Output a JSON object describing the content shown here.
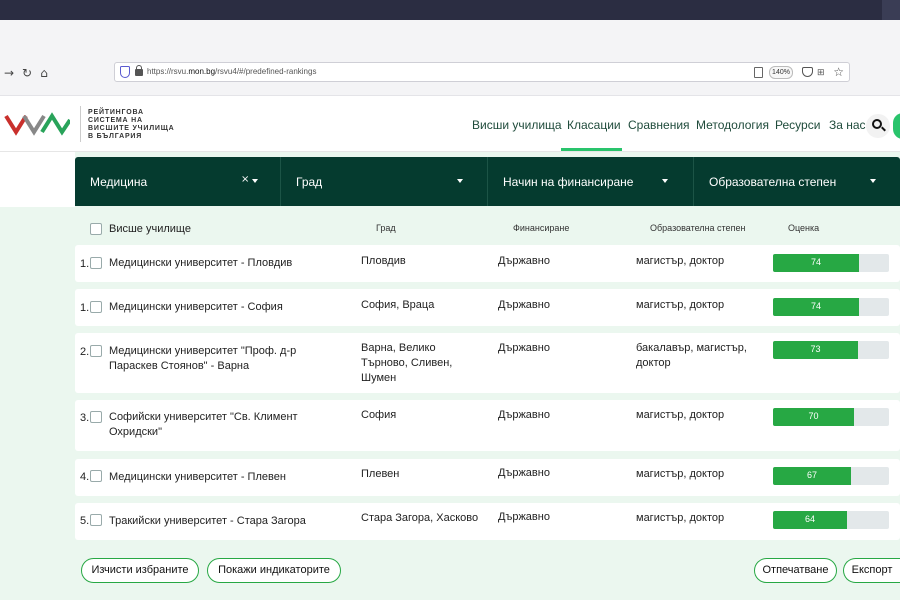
{
  "browser": {
    "url_prefix": "https://rsvu.",
    "url_domain": "mon.bg",
    "url_suffix": "/rsvu4/#/predefined-rankings",
    "zoom": "140%"
  },
  "site": {
    "logo_lines": [
      "РЕЙТИНГОВА",
      "СИСТЕМА НА",
      "ВИСШИТЕ УЧИЛИЩА",
      "В БЪЛГАРИЯ"
    ],
    "nav": [
      "Висши училища",
      "Класации",
      "Сравнения",
      "Методология",
      "Ресурси",
      "За нас"
    ],
    "active_nav": "Класации"
  },
  "filters": {
    "field": "Медицина",
    "city": "Град",
    "funding": "Начин на финансиране",
    "degree": "Образователна степен"
  },
  "table": {
    "headers": {
      "university": "Висше училище",
      "city": "Град",
      "funding": "Финансиране",
      "degree": "Образователна степен",
      "score": "Оценка"
    },
    "rows": [
      {
        "rank": "1.",
        "university": "Медицински университет - Пловдив",
        "city": "Пловдив",
        "funding": "Държавно",
        "degree": "магистър, доктор",
        "score": 74
      },
      {
        "rank": "1.",
        "university": "Медицински университет - София",
        "city": "София, Враца",
        "funding": "Държавно",
        "degree": "магистър, доктор",
        "score": 74
      },
      {
        "rank": "2.",
        "university": "Медицински университет \"Проф. д-р Параскев Стоянов\" - Варна",
        "city": "Варна, Велико Търново, Сливен, Шумен",
        "funding": "Държавно",
        "degree": "бакалавър, магистър, доктор",
        "score": 73
      },
      {
        "rank": "3.",
        "university": "Софийски университет \"Св. Климент Охридски\"",
        "city": "София",
        "funding": "Държавно",
        "degree": "магистър, доктор",
        "score": 70
      },
      {
        "rank": "4.",
        "university": "Медицински университет - Плевен",
        "city": "Плевен",
        "funding": "Държавно",
        "degree": "магистър, доктор",
        "score": 67
      },
      {
        "rank": "5.",
        "university": "Тракийски университет - Стара Загора",
        "city": "Стара Загора, Хасково",
        "funding": "Държавно",
        "degree": "магистър, доктор",
        "score": 64
      }
    ]
  },
  "actions": {
    "clear": "Изчисти избраните",
    "indicators": "Покажи индикаторите",
    "print": "Отпечатване",
    "export": "Експорт"
  },
  "colors": {
    "dark_green": "#053b2f",
    "accent_green": "#29c46c",
    "bar_green": "#27a844",
    "bg_mint": "#ebf7ef"
  }
}
